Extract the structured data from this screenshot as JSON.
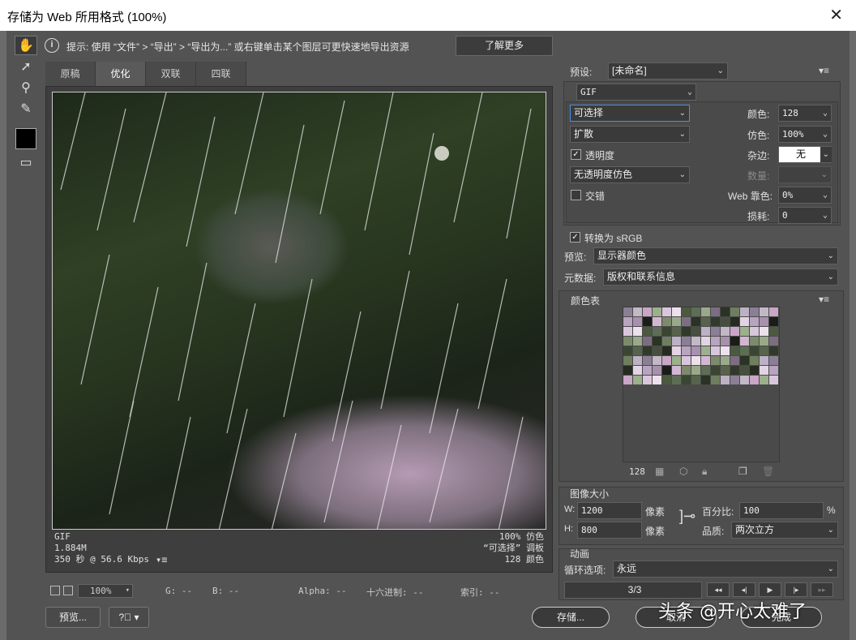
{
  "window": {
    "title": "存储为 Web 所用格式 (100%)",
    "close_glyph": "✕"
  },
  "hint": {
    "text": "提示: 使用 “文件” > “导出” > “导出为...” 或右键单击某个图层可更快速地导出资源",
    "learn_more": "了解更多"
  },
  "tabs": [
    "原稿",
    "优化",
    "双联",
    "四联"
  ],
  "preview_info": {
    "format": "GIF",
    "size": "1.884M",
    "time": "350 秒 @ 56.6 Kbps",
    "dither": "100% 仿色",
    "palette": "“可选择” 调板",
    "colors": "128 颜色"
  },
  "status": {
    "zoom": "100%",
    "g": "G: --",
    "b": "B: --",
    "alpha": "Alpha: --",
    "hex": "十六进制: --",
    "index": "索引: --"
  },
  "buttons": {
    "preview": "预览...",
    "save": "存储...",
    "cancel": "取消",
    "done": "完成"
  },
  "settings": {
    "preset_label": "预设:",
    "preset_value": "[未命名]",
    "format": "GIF",
    "reduction": "可选择",
    "dither_algo": "扩散",
    "transparency_label": "透明度",
    "transparency_dither": "无透明度仿色",
    "interlace_label": "交错",
    "colors_label": "颜色:",
    "colors_value": "128",
    "dither_label": "仿色:",
    "dither_value": "100%",
    "matte_label": "杂边:",
    "matte_value": "无",
    "amount_label": "数量:",
    "websnap_label": "Web 靠色:",
    "websnap_value": "0%",
    "lossy_label": "损耗:",
    "lossy_value": "0",
    "convert_srgb": "转换为 sRGB",
    "preview_label": "预览:",
    "preview_value": "显示器颜色",
    "metadata_label": "元数据:",
    "metadata_value": "版权和联系信息"
  },
  "color_table": {
    "title": "颜色表",
    "count": "128"
  },
  "image_size": {
    "title": "图像大小",
    "w_label": "W:",
    "w_value": "1200",
    "h_label": "H:",
    "h_value": "800",
    "unit": "像素",
    "percent_label": "百分比:",
    "percent_value": "100",
    "percent_unit": "%",
    "quality_label": "品质:",
    "quality_value": "两次立方"
  },
  "animation": {
    "title": "动画",
    "loop_label": "循环选项:",
    "loop_value": "永远",
    "frame": "3/3"
  },
  "watermark": "头条 @开心太难了"
}
